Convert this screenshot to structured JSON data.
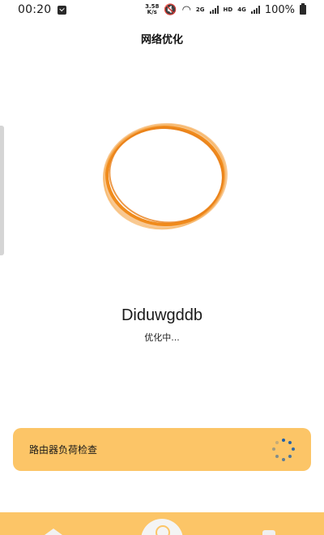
{
  "status_bar": {
    "time": "00:20",
    "net_speed_value": "3.58",
    "net_speed_unit": "K/s",
    "network_2g": "2G",
    "network_hd": "HD",
    "network_4g": "4G",
    "battery": "100%"
  },
  "page": {
    "title": "网络优化"
  },
  "optimizer": {
    "device_name": "Diduwgddb",
    "status": "优化中..."
  },
  "task": {
    "label": "路由器负荷检查"
  },
  "colors": {
    "ring": "#f08b1c",
    "card": "#fcc567",
    "spinner": "#1f5fa8"
  }
}
